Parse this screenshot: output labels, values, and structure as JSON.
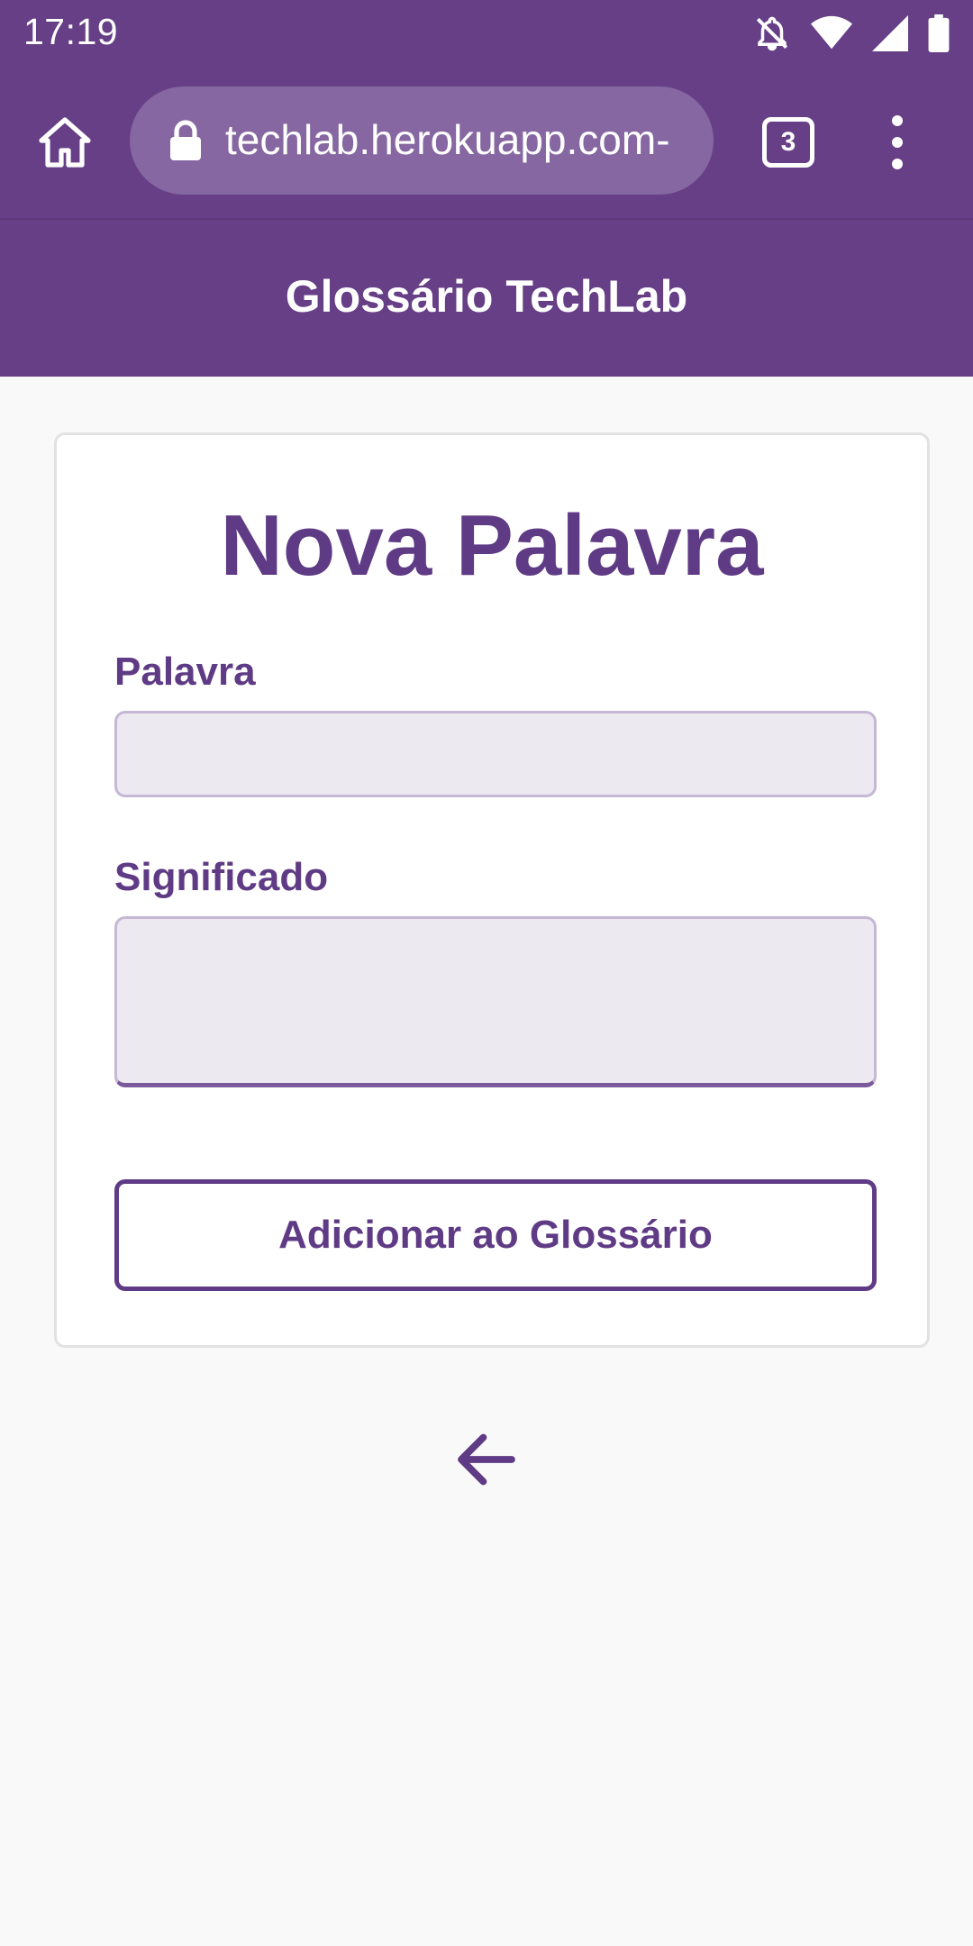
{
  "status_bar": {
    "time": "17:19",
    "icons": [
      "notifications-off-icon",
      "wifi-icon",
      "signal-icon",
      "battery-icon"
    ]
  },
  "browser": {
    "url": "-techlab.herokuapp.com",
    "tab_count": "3",
    "icons": [
      "home-icon",
      "lock-icon",
      "tabs-icon",
      "more-vert-icon"
    ]
  },
  "app": {
    "title": "Glossário TechLab"
  },
  "form": {
    "heading": "Nova Palavra",
    "word_label": "Palavra",
    "word_value": "",
    "meaning_label": "Significado",
    "meaning_value": "",
    "submit_label": "Adicionar ao Glossário"
  },
  "navigation": {
    "back_icon": "arrow-left-icon"
  },
  "colors": {
    "brand_purple": "#663f86",
    "text_purple": "#5f3b85",
    "input_bg": "#ece9f1",
    "page_bg": "#f9f9f9"
  }
}
